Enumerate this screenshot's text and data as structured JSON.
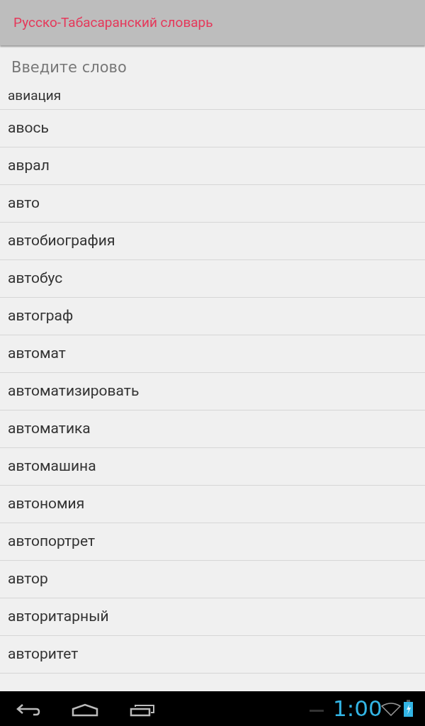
{
  "app_bar": {
    "title": "Русско-Табасаранский словарь"
  },
  "search": {
    "placeholder": "Введите слово"
  },
  "words": [
    "авиация",
    "авось",
    "аврал",
    "авто",
    "автобиография",
    "автобус",
    "автограф",
    "автомат",
    "автоматизировать",
    "автоматика",
    "автомашина",
    "автономия",
    "автопортрет",
    "автор",
    "авторитарный",
    "авторитет"
  ],
  "nav_bar": {
    "time": "1:00"
  }
}
